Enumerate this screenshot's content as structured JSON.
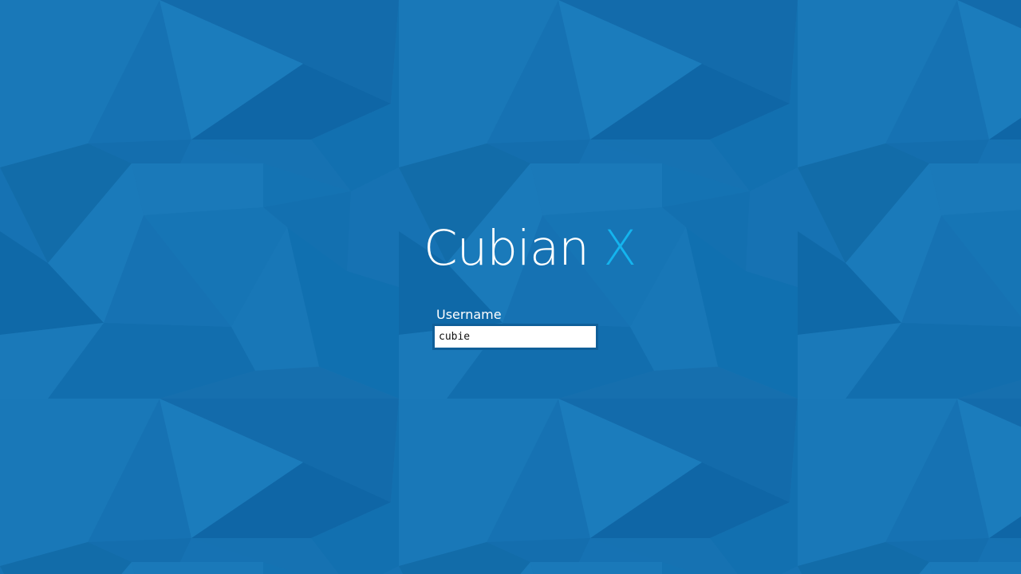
{
  "login": {
    "brand": {
      "name": "Cubian",
      "accent": "X",
      "accent_color": "#14b4ee"
    },
    "username_label": "Username",
    "username_value": "cubie"
  },
  "theme": {
    "background_color": "#1672b3",
    "background_pattern": "low-poly blue triangles"
  }
}
